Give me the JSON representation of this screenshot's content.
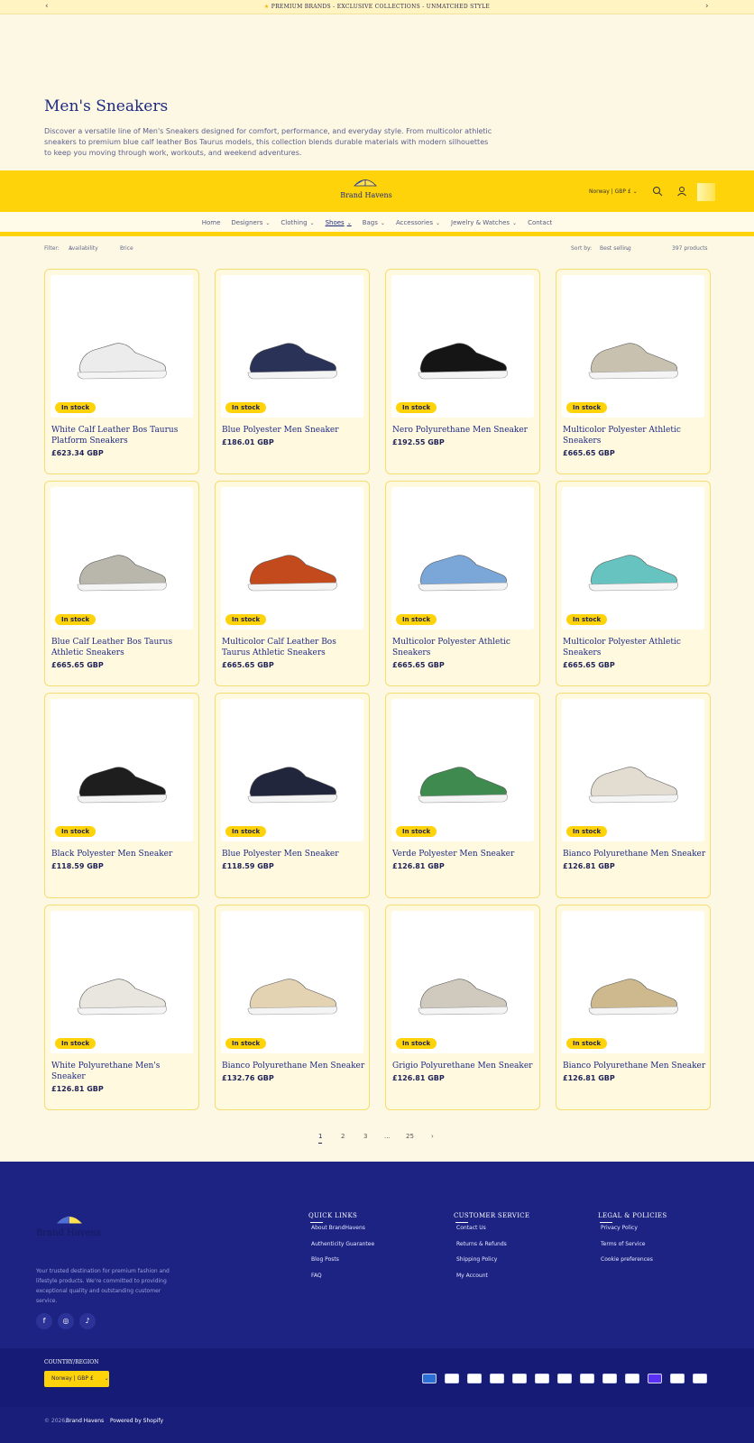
{
  "announcement": {
    "text": "PREMIUM BRANDS - EXCLUSIVE COLLECTIONS - UNMATCHED STYLE",
    "prev_icon": "chevron-left-icon",
    "next_icon": "chevron-right-icon"
  },
  "hero": {
    "title": "Men's Sneakers",
    "description": "Discover a versatile line of Men's Sneakers designed for comfort, performance, and everyday style. From multicolor athletic sneakers to premium blue calf leather Bos Taurus models, this collection blends durable materials with modern silhouettes to keep you moving through work, workouts, and weekend adventures."
  },
  "header": {
    "logo_text": "Brand Havens",
    "country_selector": "Norway | GBP £",
    "icons": [
      "search-icon",
      "account-icon",
      "cart-icon"
    ],
    "accent": "#ffd30a"
  },
  "nav": {
    "items": [
      {
        "label": "Home",
        "dropdown": false
      },
      {
        "label": "Designers",
        "dropdown": true
      },
      {
        "label": "Clothing",
        "dropdown": true
      },
      {
        "label": "Shoes",
        "dropdown": true,
        "active": true
      },
      {
        "label": "Bags",
        "dropdown": true
      },
      {
        "label": "Accessories",
        "dropdown": true
      },
      {
        "label": "Jewelry & Watches",
        "dropdown": true
      },
      {
        "label": "Contact",
        "dropdown": false
      }
    ]
  },
  "filters": {
    "label": "Filter:",
    "availability": "Availability",
    "price": "Price",
    "sort_label": "Sort by:",
    "sort_value": "Best selling",
    "product_count": "397 products"
  },
  "products": [
    {
      "title": "White Calf Leather Bos Taurus Platform Sneakers",
      "price": "£623.34 GBP",
      "badge": "In stock",
      "color": "#ececec"
    },
    {
      "title": "Blue Polyester Men Sneaker",
      "price": "£186.01 GBP",
      "badge": "In stock",
      "color": "#2b3258"
    },
    {
      "title": "Nero Polyurethane Men Sneaker",
      "price": "£192.55 GBP",
      "badge": "In stock",
      "color": "#151515"
    },
    {
      "title": "Multicolor Polyester Athletic Sneakers",
      "price": "£665.65 GBP",
      "badge": "In stock",
      "color": "#c9c1b0"
    },
    {
      "title": "Blue Calf Leather Bos Taurus Athletic Sneakers",
      "price": "£665.65 GBP",
      "badge": "In stock",
      "color": "#b9b6ac"
    },
    {
      "title": "Multicolor Calf Leather Bos Taurus Athletic Sneakers",
      "price": "£665.65 GBP",
      "badge": "In stock",
      "color": "#c24a1c"
    },
    {
      "title": "Multicolor Polyester Athletic Sneakers",
      "price": "£665.65 GBP",
      "badge": "In stock",
      "color": "#7aa6d8"
    },
    {
      "title": "Multicolor Polyester Athletic Sneakers",
      "price": "£665.65 GBP",
      "badge": "In stock",
      "color": "#66c3c0"
    },
    {
      "title": "Black Polyester Men Sneaker",
      "price": "£118.59 GBP",
      "badge": "In stock",
      "color": "#1e1e1e"
    },
    {
      "title": "Blue Polyester Men Sneaker",
      "price": "£118.59 GBP",
      "badge": "In stock",
      "color": "#22263c"
    },
    {
      "title": "Verde Polyester Men Sneaker",
      "price": "£126.81 GBP",
      "badge": "In stock",
      "color": "#3f8a4f"
    },
    {
      "title": "Bianco Polyurethane Men Sneaker",
      "price": "£126.81 GBP",
      "badge": "In stock",
      "color": "#e2ddd0"
    },
    {
      "title": "White Polyurethane Men's Sneaker",
      "price": "£126.81 GBP",
      "badge": "In stock",
      "color": "#e9e6df"
    },
    {
      "title": "Bianco Polyurethane Men Sneaker",
      "price": "£132.76 GBP",
      "badge": "In stock",
      "color": "#e3d3b3"
    },
    {
      "title": "Grigio Polyurethane Men Sneaker",
      "price": "£126.81 GBP",
      "badge": "In stock",
      "color": "#cfcabd"
    },
    {
      "title": "Bianco Polyurethane Men Sneaker",
      "price": "£126.81 GBP",
      "badge": "In stock",
      "color": "#cdb98d"
    }
  ],
  "pagination": {
    "pages": [
      "1",
      "2",
      "3",
      "...",
      "25"
    ],
    "current": "1",
    "next_icon": "chevron-right-icon"
  },
  "footer": {
    "logo_text": "Brand Havens",
    "description": "Your trusted destination for premium fashion and lifestyle products. We're committed to providing exceptional quality and outstanding customer service.",
    "socials": [
      "facebook-icon",
      "instagram-icon",
      "tiktok-icon"
    ],
    "columns": [
      {
        "title": "QUICK LINKS",
        "links": [
          "About BrandHavens",
          "Authenticity Guarantee",
          "Blog Posts",
          "FAQ"
        ]
      },
      {
        "title": "CUSTOMER SERVICE",
        "links": [
          "Contact Us",
          "Returns & Refunds",
          "Shipping Policy",
          "My Account"
        ]
      },
      {
        "title": "LEGAL & POLICIES",
        "links": [
          "Privacy Policy",
          "Terms of Service",
          "Cookie preferences"
        ]
      }
    ],
    "country_label": "COUNTRY/REGION",
    "country_value": "Norway | GBP £",
    "payments": [
      "amex-icon",
      "apple-pay-icon",
      "bancontact-icon",
      "diners-club-icon",
      "discover-icon",
      "google-pay-icon",
      "ideal-icon",
      "maestro-icon",
      "mastercard-icon",
      "paypal-icon",
      "shop-pay-icon",
      "union-pay-icon",
      "visa-icon"
    ],
    "copyright_year": "© 2026,",
    "copyright_brand": "Brand Havens",
    "powered": "Powered by Shopify",
    "bg": "#1d2383"
  }
}
